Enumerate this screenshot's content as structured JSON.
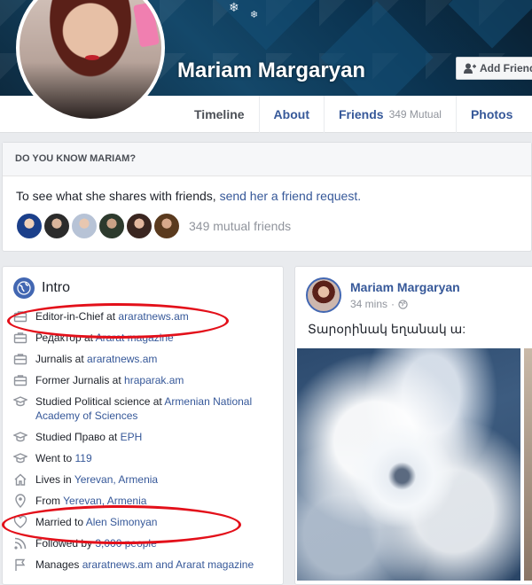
{
  "profile": {
    "name": "Mariam Margaryan",
    "add_friend_label": "Add Friend"
  },
  "nav": {
    "tabs": [
      {
        "label": "Timeline"
      },
      {
        "label": "About"
      },
      {
        "label": "Friends",
        "sub": "349 Mutual"
      },
      {
        "label": "Photos"
      }
    ]
  },
  "know_box": {
    "heading": "DO YOU KNOW MARIAM?",
    "text_prefix": "To see what she shares with friends,",
    "link": "send her a friend request.",
    "mutual_count": "349 mutual friends"
  },
  "intro": {
    "title": "Intro",
    "items": [
      {
        "prefix": "Editor-in-Chief at",
        "link": "araratnews.am",
        "icon": "briefcase-icon"
      },
      {
        "prefix": "Редактор at",
        "link": "Ararat magazine",
        "icon": "briefcase-icon"
      },
      {
        "prefix": "Jurnalis at",
        "link": "araratnews.am",
        "icon": "briefcase-icon"
      },
      {
        "prefix": "Former Jurnalis at",
        "link": "hraparak.am",
        "icon": "briefcase-icon"
      },
      {
        "prefix": "Studied Political science at",
        "link": "Armenian National Academy of Sciences",
        "icon": "graduation-cap-icon"
      },
      {
        "prefix": "Studied Право at",
        "link": "ЕРН",
        "icon": "graduation-cap-icon"
      },
      {
        "prefix": "Went to",
        "link": "119",
        "icon": "graduation-cap-icon"
      },
      {
        "prefix": "Lives in",
        "link": "Yerevan, Armenia",
        "icon": "home-icon"
      },
      {
        "prefix": "From",
        "link": "Yerevan, Armenia",
        "icon": "location-pin-icon"
      },
      {
        "prefix": "Married to",
        "link": "Alen Simonyan",
        "icon": "heart-icon"
      },
      {
        "prefix": "Followed by",
        "link": "3,000 people",
        "icon": "rss-icon"
      },
      {
        "prefix": "Manages",
        "link": "araratnews.am and Ararat magazine",
        "icon": "flag-icon"
      }
    ]
  },
  "post": {
    "author": "Mariam Margaryan",
    "time": "34 mins",
    "separator": "·",
    "text": "Տարօրինակ եղանակ ա:"
  },
  "colors": {
    "facebook_blue": "#4267b2",
    "link": "#365899",
    "annotation_red": "#e3101a"
  }
}
